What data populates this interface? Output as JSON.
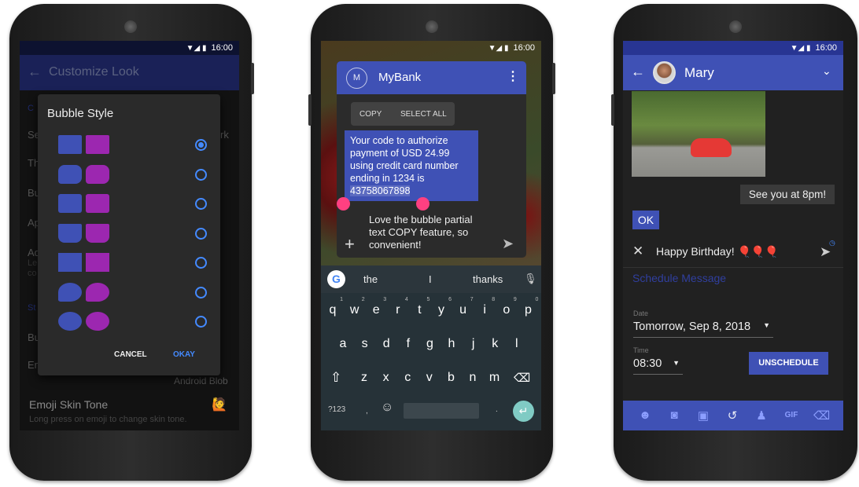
{
  "status_time": "16:00",
  "phone1": {
    "appbar_title": "Customize Look",
    "background_fragments": [
      "C",
      "Se",
      "Th",
      "Bu",
      "Ap",
      "Ad",
      "Le",
      "co",
      "St",
      "Bu",
      "Em",
      "rk"
    ],
    "android_blob": "Android Blob",
    "emoji_skin_tone_title": "Emoji Skin Tone",
    "emoji_skin_tone_subtitle": "Long press on emoji to change skin tone.",
    "dialog": {
      "title": "Bubble Style",
      "options": [
        {
          "selected": true
        },
        {
          "selected": false
        },
        {
          "selected": false
        },
        {
          "selected": false
        },
        {
          "selected": false
        },
        {
          "selected": false
        },
        {
          "selected": false
        }
      ],
      "cancel_label": "CANCEL",
      "okay_label": "OKAY"
    },
    "colors": {
      "incoming": "#3f51b5",
      "outgoing": "#9c27b0",
      "accent": "#448aff"
    }
  },
  "phone2": {
    "contact_initial": "M",
    "contact_name": "MyBank",
    "copy_label": "COPY",
    "select_all_label": "SELECT ALL",
    "message_text": "Your code to authorize payment of USD 24.99 using credit card number ending in 1234 is ",
    "message_selected": "43758067898",
    "reply_text": "Love the bubble partial text COPY feature, so convenient!",
    "suggestions": [
      "the",
      "I",
      "thanks"
    ],
    "keyboard_rows": [
      [
        "q",
        "w",
        "e",
        "r",
        "t",
        "y",
        "u",
        "i",
        "o",
        "p"
      ],
      [
        "a",
        "s",
        "d",
        "f",
        "g",
        "h",
        "j",
        "k",
        "l"
      ],
      [
        "z",
        "x",
        "c",
        "v",
        "b",
        "n",
        "m"
      ]
    ],
    "number_hints": [
      "1",
      "2",
      "3",
      "4",
      "5",
      "6",
      "7",
      "8",
      "9",
      "0"
    ],
    "symbols_key": "?123",
    "comma_key": ",",
    "period_key": "."
  },
  "phone3": {
    "contact_name": "Mary",
    "outgoing_message": "See you at 8pm!",
    "incoming_message": "OK",
    "compose_text": "Happy Birthday! 🎈🎈🎈",
    "schedule_title": "Schedule Message",
    "date_label": "Date",
    "date_value": "Tomorrow, Sep 8, 2018",
    "time_label": "Time",
    "time_value": "08:30",
    "unschedule_label": "UNSCHEDULE",
    "gif_label": "GIF",
    "colors": {
      "primary": "#3f51b5"
    }
  }
}
